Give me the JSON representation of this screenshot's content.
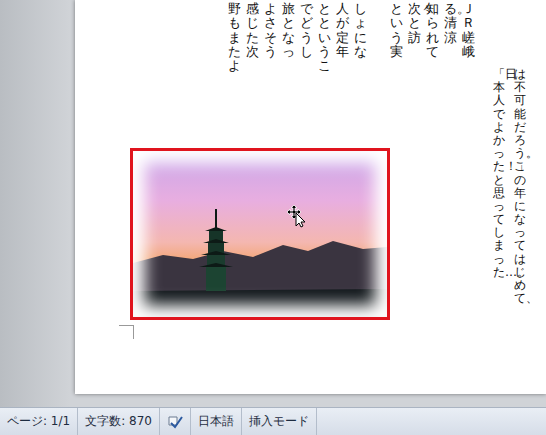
{
  "document": {
    "top_columns": [
      "ＪＲ嵯峨",
      "る。清涼",
      "知られて",
      "次々と訪",
      "という実",
      "",
      "しょにな",
      "人が定年",
      "とというこ",
      "でどうし",
      "旅となっ",
      "よさそう",
      "感じた次",
      "野もまたよ"
    ],
    "right_columns": [
      "は不可能だろう。この年になってはじめて、",
      "「日本人でよかった！」と思ってしまった…。"
    ],
    "image": {
      "selected": true
    }
  },
  "status_bar": {
    "page": "ページ: 1/1",
    "word_count": "文字数: 870",
    "language": "日本語",
    "mode": "挿入モード"
  }
}
